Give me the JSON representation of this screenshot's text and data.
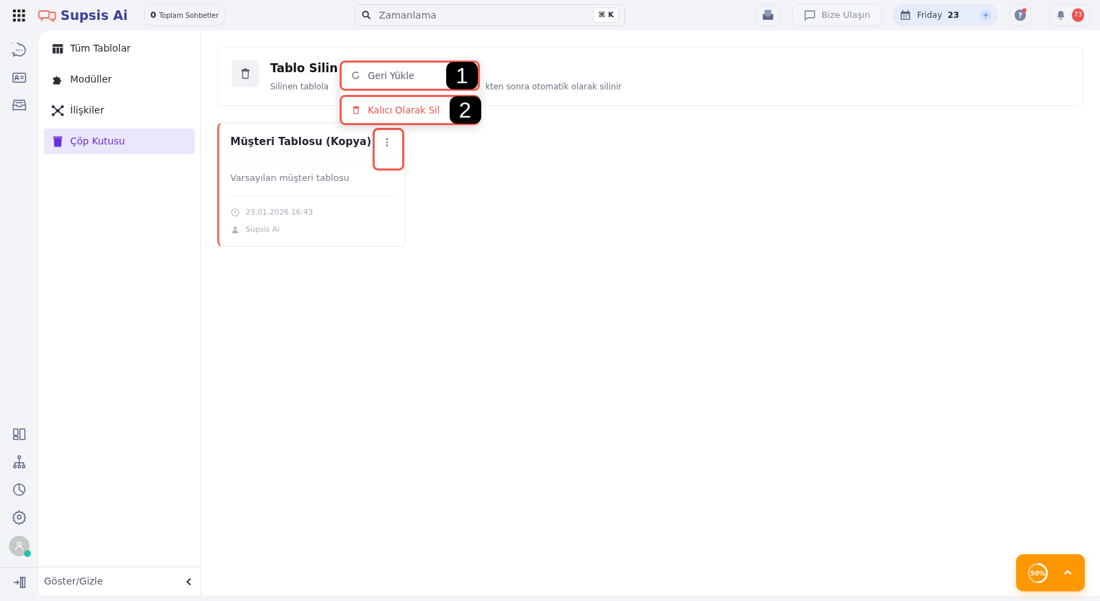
{
  "topbar": {
    "brand": "Supsis Ai",
    "chat_count": "0",
    "chat_label": "Toplam Sohbetler",
    "search": {
      "value": "Zamanlama",
      "shortcut": "⌘ K"
    },
    "contact": "Bize Ulaşın",
    "date": {
      "day": "Friday",
      "number": "23"
    },
    "help_label": "?",
    "help_alert": true,
    "notifications": "73"
  },
  "sidebar": {
    "items": [
      {
        "kind": "table",
        "label": "Tüm Tablolar",
        "selected": false
      },
      {
        "kind": "module",
        "label": "Modüller",
        "selected": false
      },
      {
        "kind": "relation",
        "label": "İlişkiler",
        "selected": false
      },
      {
        "kind": "trash",
        "label": "Çöp Kutusu",
        "selected": true
      }
    ],
    "toggle": "Göster/Gizle"
  },
  "header": {
    "title": "Tablo Silin",
    "subtitle_start": "Silinen tablola",
    "subtitle_end": "kten sonra otomatik olarak silinir"
  },
  "cards": [
    {
      "title": "Müşteri Tablosu (Kopya)",
      "description": "Varsayılan müşteri tablosu",
      "date": "23.01.2026 16:43",
      "owner": "Supsis Ai",
      "highlighted": true
    }
  ],
  "context_menu": [
    {
      "kind": "restore",
      "label": "Geri Yükle"
    },
    {
      "kind": "delete",
      "label": "Kalıcı Olarak Sil"
    }
  ],
  "annotations": [
    {
      "label": "1"
    },
    {
      "label": "2"
    }
  ],
  "progress_widget": {
    "level": 0.5,
    "reading": "50%"
  }
}
